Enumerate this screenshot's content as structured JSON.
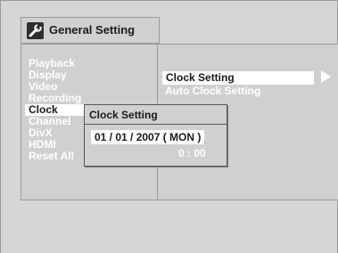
{
  "title": {
    "text": "General Setting",
    "icon": "wrench-icon"
  },
  "menu": {
    "items": [
      {
        "label": "Playback"
      },
      {
        "label": "Display"
      },
      {
        "label": "Video"
      },
      {
        "label": "Recording"
      },
      {
        "label": "Clock"
      },
      {
        "label": "Channel"
      },
      {
        "label": "DivX"
      },
      {
        "label": "HDMI"
      },
      {
        "label": "Reset All"
      }
    ],
    "selected_index": 4
  },
  "submenu": {
    "items": [
      {
        "label": "Clock Setting"
      },
      {
        "label": "Auto Clock Setting"
      }
    ],
    "selected_index": 0,
    "arrow_icon": "right-arrow-icon"
  },
  "popup": {
    "title": "Clock Setting",
    "date": "01 / 01 / 2007 ( MON )",
    "time": "0 : 00"
  },
  "colors": {
    "panel_bg": "#d0d0d0",
    "text_unselected": "#ffffff",
    "text_selected": "#1a1a1a",
    "highlight": "#ffffff"
  }
}
